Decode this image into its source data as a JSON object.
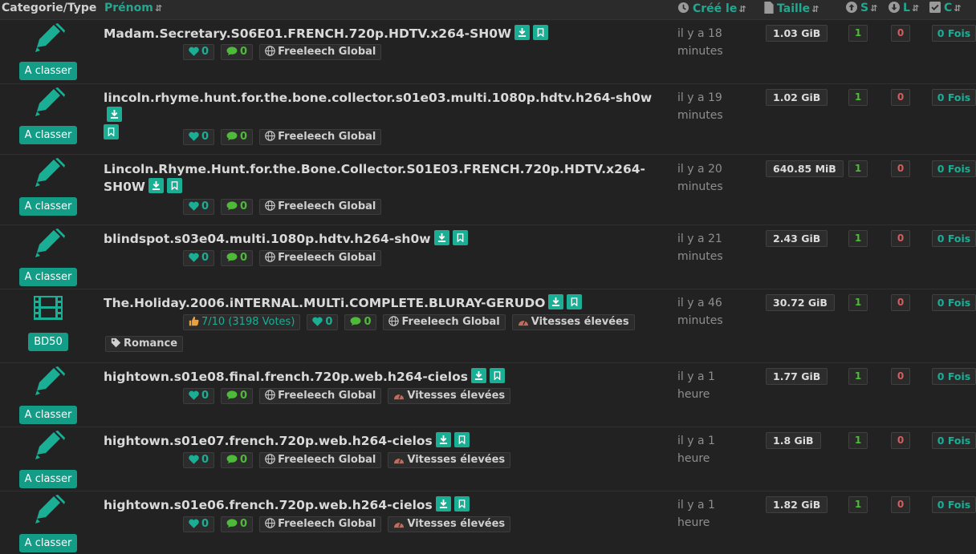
{
  "header": {
    "category": "Categorie/Type",
    "name": "Prénom",
    "created": "Créé le",
    "size": "Taille",
    "seeders": "S",
    "leechers": "L",
    "completed": "C"
  },
  "colors": {
    "accent": "#1aae94",
    "seed": "#4fba3a",
    "leech": "#d55d5d",
    "background": "#222223"
  },
  "rows": [
    {
      "category_icon": "pencil-icon",
      "category": "A classer",
      "title": "Madam.Secretary.S06E01.FRENCH.720p.HDTV.x264-SH0W",
      "likes": "0",
      "comments": "0",
      "freeleech": "Freeleech Global",
      "created": "il y a 18 minutes",
      "size": "1.03 GiB",
      "seeders": "1",
      "leechers": "0",
      "completed": "0 Fois"
    },
    {
      "category_icon": "pencil-icon",
      "category": "A classer",
      "title": "lincoln.rhyme.hunt.for.the.bone.collector.s01e03.multi.1080p.hdtv.h264-sh0w",
      "likes": "0",
      "comments": "0",
      "freeleech": "Freeleech Global",
      "created": "il y a 19 minutes",
      "size": "1.02 GiB",
      "seeders": "1",
      "leechers": "0",
      "completed": "0 Fois"
    },
    {
      "category_icon": "pencil-icon",
      "category": "A classer",
      "title": "Lincoln.Rhyme.Hunt.for.the.Bone.Collector.S01E03.FRENCH.720p.HDTV.x264-SH0W",
      "likes": "0",
      "comments": "0",
      "freeleech": "Freeleech Global",
      "created": "il y a 20 minutes",
      "size": "640.85 MiB",
      "seeders": "1",
      "leechers": "0",
      "completed": "0 Fois"
    },
    {
      "category_icon": "pencil-icon",
      "category": "A classer",
      "title": "blindspot.s03e04.multi.1080p.hdtv.h264-sh0w",
      "likes": "0",
      "comments": "0",
      "freeleech": "Freeleech Global",
      "created": "il y a 21 minutes",
      "size": "2.43 GiB",
      "seeders": "1",
      "leechers": "0",
      "completed": "0 Fois"
    },
    {
      "category_icon": "film-icon",
      "category": "BD50",
      "title": "The.Holiday.2006.iNTERNAL.MULTi.COMPLETE.BLURAY-GERUDO",
      "rating": "7/10 (3198 Votes)",
      "likes": "0",
      "comments": "0",
      "freeleech": "Freeleech Global",
      "speed": "Vitesses élevées",
      "tag": "Romance",
      "created": "il y a 46 minutes",
      "size": "30.72 GiB",
      "seeders": "1",
      "leechers": "0",
      "completed": "0 Fois"
    },
    {
      "category_icon": "pencil-icon",
      "category": "A classer",
      "title": "hightown.s01e08.final.french.720p.web.h264-cielos",
      "likes": "0",
      "comments": "0",
      "freeleech": "Freeleech Global",
      "speed": "Vitesses élevées",
      "created": "il y a 1 heure",
      "size": "1.77 GiB",
      "seeders": "1",
      "leechers": "0",
      "completed": "0 Fois"
    },
    {
      "category_icon": "pencil-icon",
      "category": "A classer",
      "title": "hightown.s01e07.french.720p.web.h264-cielos",
      "likes": "0",
      "comments": "0",
      "freeleech": "Freeleech Global",
      "speed": "Vitesses élevées",
      "created": "il y a 1 heure",
      "size": "1.8 GiB",
      "seeders": "1",
      "leechers": "0",
      "completed": "0 Fois"
    },
    {
      "category_icon": "pencil-icon",
      "category": "A classer",
      "title": "hightown.s01e06.french.720p.web.h264-cielos",
      "likes": "0",
      "comments": "0",
      "freeleech": "Freeleech Global",
      "speed": "Vitesses élevées",
      "created": "il y a 1 heure",
      "size": "1.82 GiB",
      "seeders": "1",
      "leechers": "0",
      "completed": "0 Fois"
    }
  ]
}
